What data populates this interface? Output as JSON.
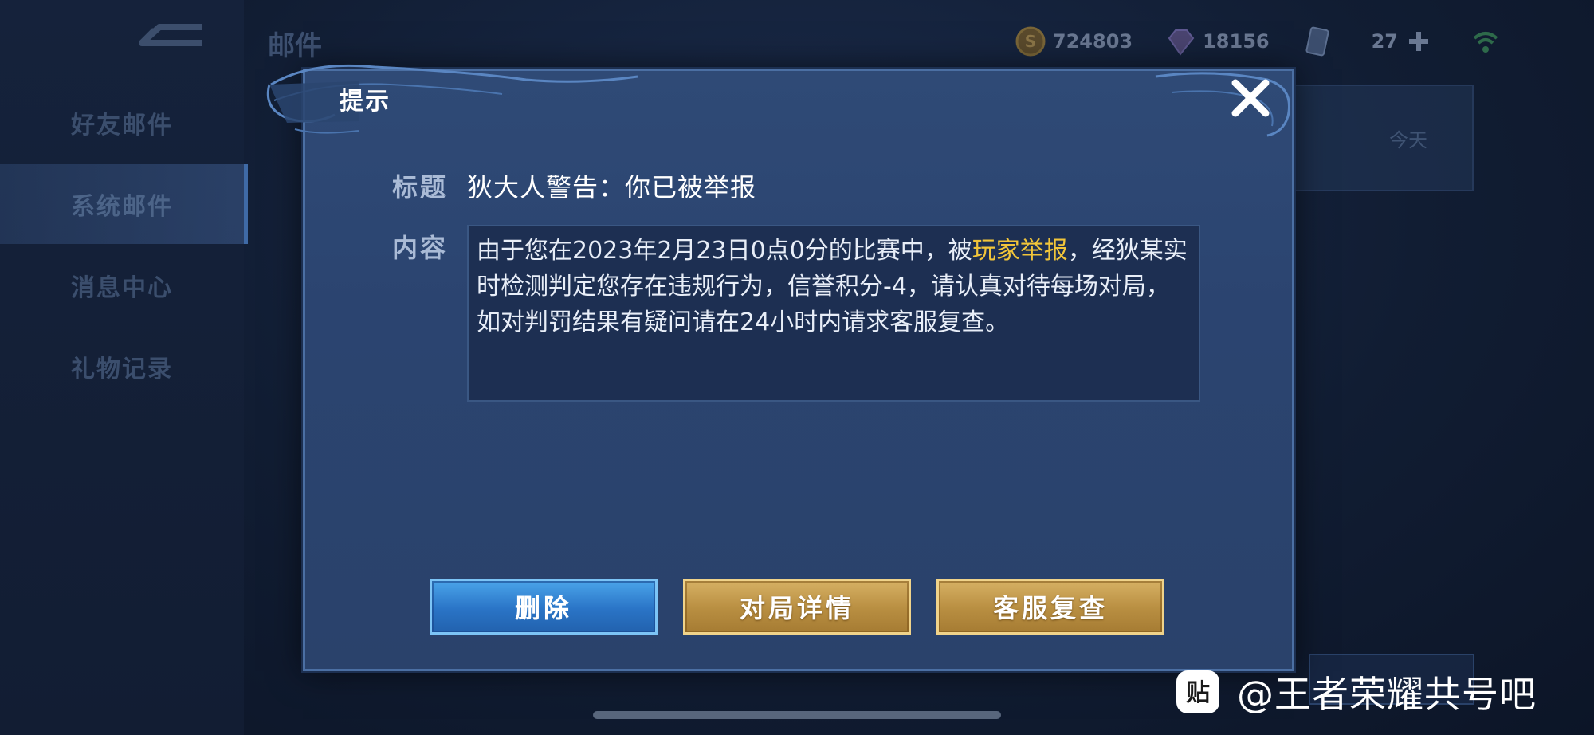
{
  "background": {
    "page_title": "邮件",
    "sidebar": {
      "items": [
        {
          "label": "好友邮件",
          "active": false
        },
        {
          "label": "系统邮件",
          "active": true
        },
        {
          "label": "消息中心",
          "active": false
        },
        {
          "label": "礼物记录",
          "active": false
        }
      ]
    },
    "resources": {
      "coins": "724803",
      "gems": "18156",
      "tickets": "27"
    },
    "list_item_date": "今天"
  },
  "modal": {
    "title": "提示",
    "title_label": "标题",
    "title_value": "狄大人警告：你已被举报",
    "content_label": "内容",
    "content": {
      "before": "由于您在2023年2月23日0点0分的比赛中，被",
      "highlight": "玩家举报",
      "after": "，经狄某实时检测判定您存在违规行为，信誉积分-4，请认真对待每场对局，如对判罚结果有疑问请在24小时内请求客服复查。"
    },
    "buttons": {
      "delete": "删除",
      "match_details": "对局详情",
      "customer_review": "客服复查"
    }
  },
  "watermark": {
    "logo_text": "贴",
    "text": "@王者荣耀共号吧"
  },
  "colors": {
    "highlight": "#f1c53a",
    "delete_button": "#2a74c6",
    "gold_button": "#b88e41"
  }
}
